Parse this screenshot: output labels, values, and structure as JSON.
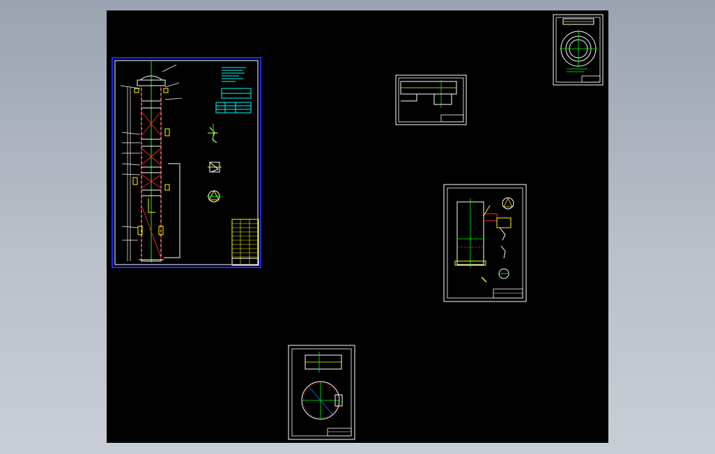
{
  "viewer": {
    "background_color": "#a5adb9",
    "canvas_color": "#000000"
  },
  "colors": {
    "frame_white": "#ffffff",
    "frame_blue": "#1a2bff",
    "line_yellow": "#ffff00",
    "line_red": "#ff2020",
    "line_green": "#00ff00",
    "line_cyan": "#00ffff",
    "line_blue_light": "#6aa8ff",
    "line_magenta": "#ff40ff"
  },
  "sheets": [
    {
      "id": "main-tower-assembly",
      "frame": "blue",
      "active": true
    },
    {
      "id": "flange-detail",
      "frame": "white"
    },
    {
      "id": "nozzle-section",
      "frame": "white"
    },
    {
      "id": "tank-assembly",
      "frame": "white"
    },
    {
      "id": "plate-detail",
      "frame": "white"
    }
  ]
}
